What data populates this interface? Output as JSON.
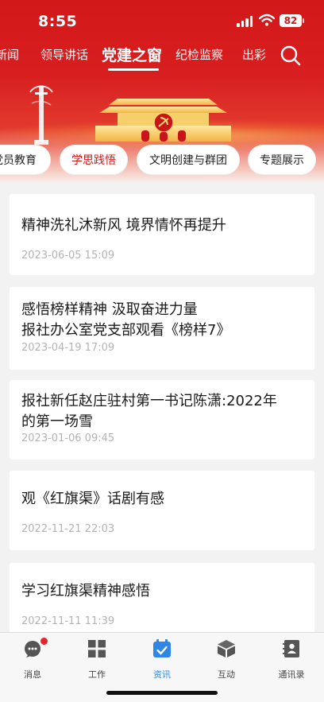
{
  "status_bar": {
    "time": "8:55",
    "battery": "82"
  },
  "top_tabs": [
    {
      "label": "新闻"
    },
    {
      "label": "领导讲话"
    },
    {
      "label": "党建之窗"
    },
    {
      "label": "纪检监察"
    },
    {
      "label": "出彩"
    }
  ],
  "active_top_tab": "党建之窗",
  "categories": [
    {
      "label": "党员教育"
    },
    {
      "label": "学思践悟"
    },
    {
      "label": "文明创建与群团"
    },
    {
      "label": "专题展示"
    }
  ],
  "active_category": "学思践悟",
  "articles": [
    {
      "title_lines": [
        "精神洗礼沐新风 境界情怀再提升"
      ],
      "date": "2023-06-05 15:09"
    },
    {
      "title_lines": [
        "感悟榜样精神 汲取奋进力量",
        "报社办公室党支部观看《榜样7》"
      ],
      "date": "2023-04-19 17:09"
    },
    {
      "title_lines": [
        "报社新任赵庄驻村第一书记陈潇:2022年",
        "的第一场雪"
      ],
      "date": "2023-01-06 09:45"
    },
    {
      "title_lines": [
        "观《红旗渠》话剧有感"
      ],
      "date": "2022-11-21 22:03"
    },
    {
      "title_lines": [
        "学习红旗渠精神感悟"
      ],
      "date": "2022-11-11 11:39"
    }
  ],
  "bottom_nav": [
    {
      "label": "消息",
      "icon": "message-icon",
      "badge": true
    },
    {
      "label": "工作",
      "icon": "grid-icon",
      "badge": false
    },
    {
      "label": "资讯",
      "icon": "calendar-check-icon",
      "badge": false,
      "active": true
    },
    {
      "label": "互动",
      "icon": "cube-icon",
      "badge": false
    },
    {
      "label": "通讯录",
      "icon": "contacts-icon",
      "badge": false
    }
  ],
  "colors": {
    "brand_red": "#d3181a",
    "active_blue": "#2f86e6",
    "badge_red": "#e5242b"
  }
}
